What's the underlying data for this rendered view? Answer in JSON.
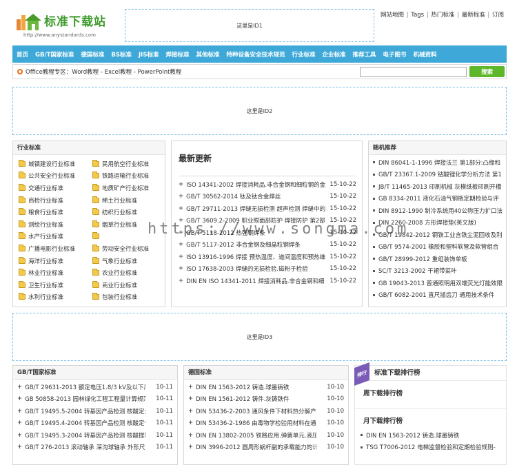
{
  "logo": {
    "title": "标准下载站",
    "url": "http://www.anystandards.com"
  },
  "ads": {
    "id1": "这里是ID1",
    "id2": "这里是ID2",
    "id3": "这里是ID3"
  },
  "toplinks": [
    "网站地图",
    "Tags",
    "热门标准",
    "最新标准",
    "订阅"
  ],
  "nav": [
    "首页",
    "GB/T国家标准",
    "德国标准",
    "BS标准",
    "JIS标准",
    "焊接标准",
    "其他标准",
    "特种设备安全技术规范",
    "行业标准",
    "企业标准",
    "推荐工具",
    "电子图书",
    "机械资料"
  ],
  "subbar": {
    "text": "Office教程专区：Word教程 - Excel教程 - PowerPoint教程",
    "search_button": "搜索",
    "search_value": ""
  },
  "industry": {
    "title": "行业标准",
    "items": [
      "城镇建设行业标准",
      "民用航空行业标准",
      "公共安全行业标准",
      "铁路运输行业标准",
      "交通行业标准",
      "地质矿产行业标准",
      "商检行业标准",
      "稀土行业标准",
      "粮食行业标准",
      "纺织行业标准",
      "测绘行业标准",
      "烟草行业标准",
      "水产行业标准",
      "",
      "广播电影行业标准",
      "劳动安全行业标准",
      "海洋行业标准",
      "气象行业标准",
      "林业行业标准",
      "农业行业标准",
      "卫生行业标准",
      "商业行业标准",
      "水利行业标准",
      "包装行业标准"
    ]
  },
  "latest": {
    "title": "最新更新",
    "rows": [
      {
        "t": "ISO 14341-2002 焊接消耗品.非合金钢和细粒钢的金",
        "d": "15-10-22"
      },
      {
        "t": "GB/T 30562-2014 钛及钛合金焊丝",
        "d": "15-10-22"
      },
      {
        "t": "GB/T 29711-2013 焊缝无损检测 超声检测 焊缝中的",
        "d": "15-10-22"
      },
      {
        "t": "GB/T 3609.2-2009 职业眼面部防护 焊接防护 第2部",
        "d": "15-10-22"
      },
      {
        "t": "GB/T 5118-2012 热强钢焊条",
        "d": "15-10-22"
      },
      {
        "t": "GB/T 5117-2012 非合金钢及细晶粒钢焊条",
        "d": "15-10-22"
      },
      {
        "t": "ISO 13916-1996 焊接 预热温度、道间温度和预热维",
        "d": "15-10-22"
      },
      {
        "t": "ISO 17638-2003 焊缝的无损检验.磁粉子检验",
        "d": "15-10-22"
      },
      {
        "t": "DIN EN ISO 14341-2011 焊接消耗品.非合金钢和细",
        "d": "15-10-22"
      }
    ]
  },
  "random": {
    "title": "随机推荐",
    "rows": [
      "DIN 86041-1-1996 焊接法兰 第1部分:凸缘和",
      "GB/T 23367.1-2009 钴酸锂化学分析方法 第1",
      "JB/T 11465-2013 印刷机械 灰模纸板印刷开槽",
      "GB 8334-2011 液化石油气钢瓶定期检验与评",
      "DIN 8912-1990 制冷系统用40公称压力扩口法",
      "DIN 2260-2008 方形焊接垫(英文版)",
      "GB/T 19842-2012 钢铁工业含铁尘泥回收及利",
      "GB/T 9574-2001 橡胶和塑料软管及软管组合",
      "GB/T 28999-2012 重组装饰单板",
      "SC/T 3213-2002 干裙带菜叶",
      "GB 19043-2013 普通照明用双端荧光灯能效限",
      "GB/T 6082-2001 直尺插齿刀 通用技术条件"
    ]
  },
  "gbt": {
    "title": "GB/T国家标准",
    "rows": [
      {
        "t": "GB/T 29631-2013 额定电压1.8/3 kV及以下风",
        "d": "10-11"
      },
      {
        "t": "GB 50858-2013 园林绿化工程工程量计算规范",
        "d": "10-11"
      },
      {
        "t": "GB/T 19495.5-2004 转基因产品检测 核酸定量",
        "d": "10-11"
      },
      {
        "t": "GB/T 19495.4-2004 转基因产品检测 核酸定性",
        "d": "10-11"
      },
      {
        "t": "GB/T 19495.3-2004 转基因产品检测 核酸提取",
        "d": "10-11"
      },
      {
        "t": "GB/T 276-2013 滚动轴承 深沟球轴承 外形尺寸",
        "d": "10-11"
      }
    ]
  },
  "german": {
    "title": "德国标准",
    "rows": [
      {
        "t": "DIN EN 1563-2012 铸造.球墨铸铁",
        "d": "10-10"
      },
      {
        "t": "DIN EN 1561-2012 铸件.灰铸铁件",
        "d": "10-10"
      },
      {
        "t": "DIN 53436-2-2003 通风条件下材料热分解产",
        "d": "10-10"
      },
      {
        "t": "DIN 53436-2-1986 由毒物学检验用材料在通",
        "d": "10-10"
      },
      {
        "t": "DIN EN 13802-2005 铁路应用.弹簧单元.液压",
        "d": "10-10"
      },
      {
        "t": "DIN 3996-2012 圆周形蜗杆副的承载能力的计",
        "d": "10-10"
      }
    ]
  },
  "ranking": {
    "tag": "排行",
    "title": "标准下载排行榜",
    "week": "周下载排行榜",
    "month": "月下载排行榜",
    "month_rows": [
      "DIN EN 1563-2012 铸造.球墨铸铁",
      "TSG T7006-2012 电梯监督检验和定期检验规则-"
    ]
  },
  "watermark": "https://www.songma.com"
}
